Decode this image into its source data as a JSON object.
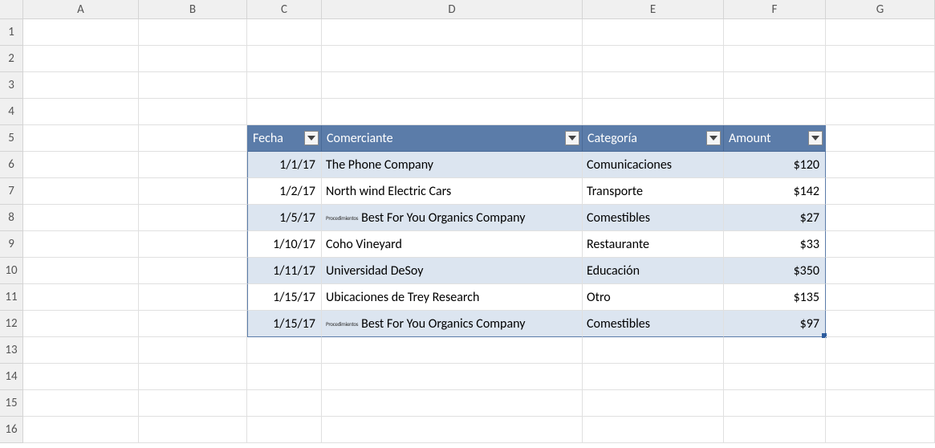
{
  "columns": [
    "A",
    "B",
    "C",
    "D",
    "E",
    "F",
    "G"
  ],
  "rows": [
    "1",
    "2",
    "3",
    "4",
    "5",
    "6",
    "7",
    "8",
    "9",
    "10",
    "11",
    "12",
    "13",
    "14",
    "15",
    "16"
  ],
  "table": {
    "headers": {
      "fecha": "Fecha",
      "comerciante": "Comerciante",
      "categoria": "Categoría",
      "amount": "Amount"
    },
    "data": [
      {
        "fecha": "1/1/17",
        "comerciante": "The Phone Company",
        "categoria": "Comunicaciones",
        "amount": "$120",
        "prefix": ""
      },
      {
        "fecha": "1/2/17",
        "comerciante": "North wind Electric Cars",
        "categoria": "Transporte",
        "amount": "$142",
        "prefix": ""
      },
      {
        "fecha": "1/5/17",
        "comerciante": "Best For You Organics Company",
        "categoria": "Comestibles",
        "amount": "$27",
        "prefix": "Procedimientos"
      },
      {
        "fecha": "1/10/17",
        "comerciante": "Coho Vineyard",
        "categoria": "Restaurante",
        "amount": "$33",
        "prefix": ""
      },
      {
        "fecha": "1/11/17",
        "comerciante": "Universidad DeSoy",
        "categoria": "Educación",
        "amount": "$350",
        "prefix": ""
      },
      {
        "fecha": "1/15/17",
        "comerciante": "Ubicaciones de Trey Research",
        "categoria": "Otro",
        "amount": "$135",
        "prefix": ""
      },
      {
        "fecha": "1/15/17",
        "comerciante": "Best For You Organics Company",
        "categoria": "Comestibles",
        "amount": "$97",
        "prefix": "Procedimientos"
      }
    ]
  },
  "chart_data": {
    "type": "table",
    "columns": [
      "Fecha",
      "Comerciante",
      "Categoría",
      "Amount"
    ],
    "rows": [
      [
        "1/1/17",
        "The Phone Company",
        "Comunicaciones",
        120
      ],
      [
        "1/2/17",
        "North wind Electric Cars",
        "Transporte",
        142
      ],
      [
        "1/5/17",
        "Best For You Organics Company",
        "Comestibles",
        27
      ],
      [
        "1/10/17",
        "Coho Vineyard",
        "Restaurante",
        33
      ],
      [
        "1/11/17",
        "Universidad DeSoy",
        "Educación",
        350
      ],
      [
        "1/15/17",
        "Ubicaciones de Trey Research",
        "Otro",
        135
      ],
      [
        "1/15/17",
        "Best For You Organics Company",
        "Comestibles",
        97
      ]
    ]
  }
}
